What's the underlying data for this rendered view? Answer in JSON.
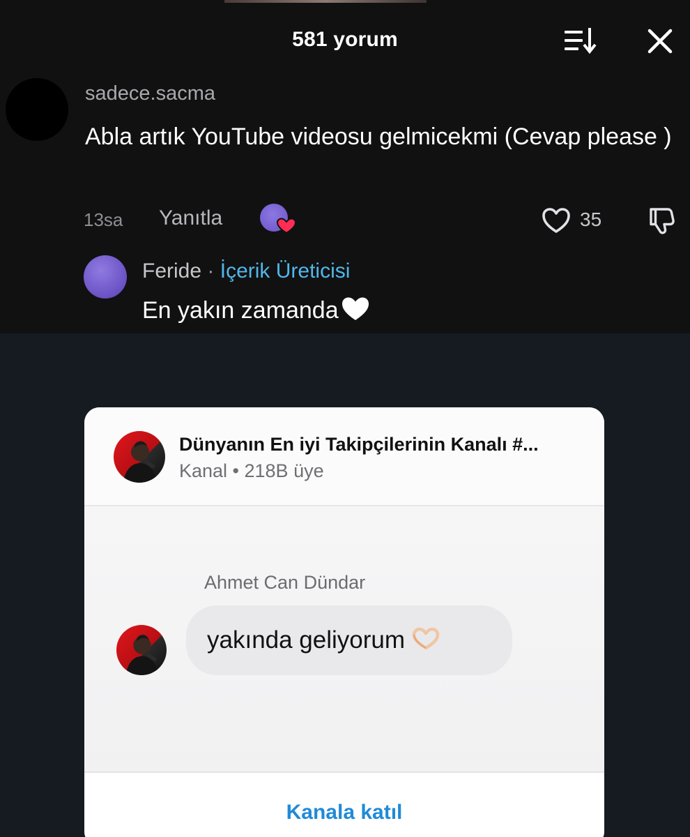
{
  "comments_sheet": {
    "title": "581 yorum",
    "sort_icon": "sort-icon",
    "close_icon": "close-icon"
  },
  "comment": {
    "username": "sadece.sacma",
    "text": "Abla artık YouTube videosu gelmicekmi (Cevap please )",
    "time": "13sa",
    "reply_label": "Yanıtla",
    "like_count": "35"
  },
  "reply": {
    "author": "Feride",
    "separator": "·",
    "badge": "İçerik Üreticisi",
    "text": "En yakın zamanda"
  },
  "channel_card": {
    "title": "Dünyanın En iyi Takipçilerinin Kanalı #...",
    "subtitle": "Kanal • 218B üye",
    "sender": "Ahmet Can Dündar",
    "message": "yakında geliyorum",
    "join_label": "Kanala katıl"
  },
  "colors": {
    "sheet_bg": "#111112",
    "page_bg": "#161b22",
    "creator_badge": "#52b7ea",
    "join_link": "#1f8ad8"
  }
}
